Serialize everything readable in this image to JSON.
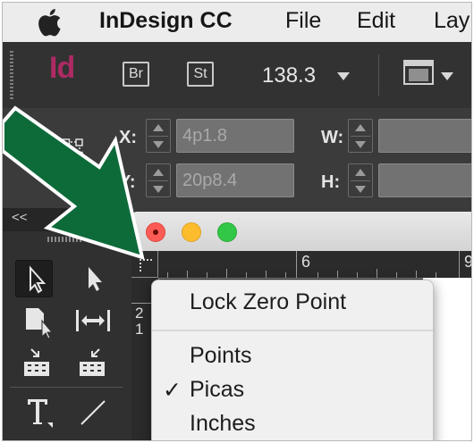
{
  "menubar": {
    "app_name": "InDesign CC",
    "menus": [
      "File",
      "Edit",
      "Lay"
    ]
  },
  "appbar": {
    "logo": "Id",
    "bridge": "Br",
    "stock": "St",
    "zoom": "138.3"
  },
  "control": {
    "x_label": "X:",
    "x_value": "4p1.8",
    "y_label": "Y:",
    "y_value": "20p8.4",
    "w_label": "W:",
    "h_label": "H:"
  },
  "tools": {
    "collapse": "<<"
  },
  "ruler": {
    "h_labels": [
      "6",
      "9"
    ],
    "v_labels": [
      "2",
      "1"
    ]
  },
  "context_menu": {
    "items": [
      "Lock Zero Point",
      "Points",
      "Picas",
      "Inches"
    ],
    "checked": "Picas",
    "check_mark": "✓"
  },
  "colors": {
    "indesign_brand": "#ad2a64",
    "annotation_arrow": "#0d6b3a",
    "close": "#fc5c56",
    "minimize": "#fdbc2e",
    "zoom": "#33c748"
  },
  "icons": [
    "apple-icon",
    "reference-point-icon",
    "selection-tool-icon",
    "direct-selection-tool-icon",
    "page-tool-icon",
    "gap-tool-icon",
    "content-collector-icon",
    "content-placer-icon",
    "type-tool-icon",
    "line-tool-icon",
    "view-options-icon"
  ]
}
